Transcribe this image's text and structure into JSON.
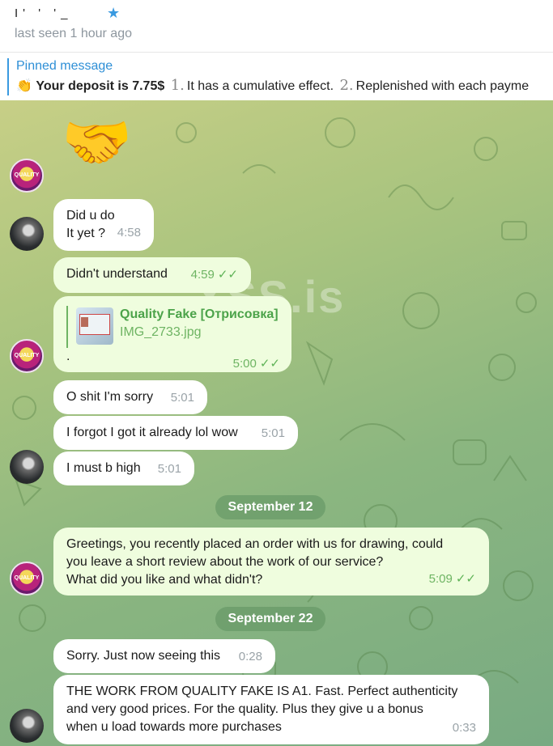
{
  "header": {
    "contact_name": "I'  ' '_",
    "status": "last seen 1 hour ago"
  },
  "pinned": {
    "title": "Pinned message",
    "emoji": "👏",
    "bold_text": "Your deposit is 7.75$",
    "num1": "1.",
    "text1": "It has a cumulative effect.",
    "num2": "2.",
    "text2": "Replenished with each payme"
  },
  "watermark": "XSS.is",
  "messages": {
    "m1": {
      "text_line1": "Did u do",
      "text_line2": "It yet ?",
      "time": "4:58"
    },
    "m2": {
      "text": "Didn't understand",
      "time": "4:59"
    },
    "m3": {
      "file_title": "Quality Fake [Отрисовка]",
      "file_name": "IMG_2733.jpg",
      "caption": ".",
      "time": "5:00"
    },
    "m4": {
      "text": "O shit I'm sorry",
      "time": "5:01"
    },
    "m5": {
      "text": "I forgot I got it already lol wow",
      "time": "5:01"
    },
    "m6": {
      "text": "I must b high",
      "time": "5:01"
    },
    "m7": {
      "text_line1": "Greetings, you recently placed an order with us for drawing, could",
      "text_line2": "you leave a short review about the work of our service?",
      "text_line3": "What did you like and what didn't?",
      "time": "5:09"
    },
    "m8": {
      "text": "Sorry. Just now seeing this",
      "time": "0:28"
    },
    "m9": {
      "text_line1": "THE WORK FROM QUALITY FAKE IS A1.   Fast.  Perfect authenticity",
      "text_line2": "and very good prices. For the quality.  Plus they give u a bonus",
      "text_line3": "when u load towards more purchases",
      "time": "0:33"
    }
  },
  "dates": {
    "d1": "September 12",
    "d2": "September 22"
  },
  "avatar_label": "QUALITY",
  "colors": {
    "accent": "#3a9ae0",
    "outgoing_bubble": "#effdde",
    "check": "#5fb357"
  }
}
